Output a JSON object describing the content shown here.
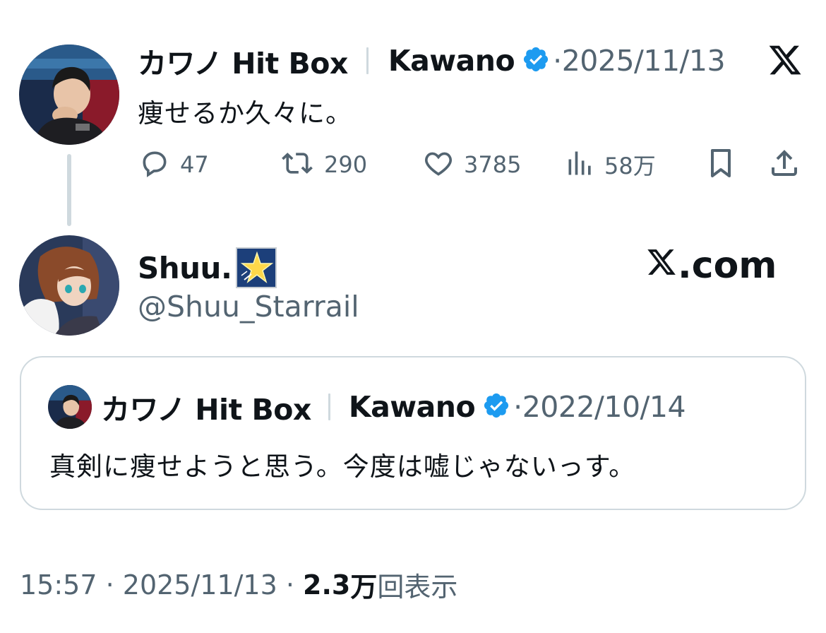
{
  "parent_tweet": {
    "author_name": "カワノ Hit Box",
    "author_handle_name": "Kawano",
    "date": "2025/11/13",
    "text": "痩せるか久々に。",
    "metrics": {
      "replies": "47",
      "retweets": "290",
      "likes": "3785",
      "views": "58万"
    }
  },
  "reply": {
    "author_name": "Shuu.",
    "handle": "@Shuu_Starrail",
    "site_label": ".com"
  },
  "quoted_tweet": {
    "author_name": "カワノ Hit Box",
    "author_handle_name": "Kawano",
    "date": "2022/10/14",
    "text": "真剣に痩せようと思う。今度は嘘じゃないっす。"
  },
  "footer": {
    "time": "15:57",
    "date": "2025/11/13",
    "views_count": "2.3",
    "views_unit": "万",
    "views_suffix": "回表示"
  },
  "icons": [
    "x-logo",
    "verified-badge",
    "reply-icon",
    "retweet-icon",
    "like-icon",
    "views-icon",
    "bookmark-icon",
    "share-icon",
    "star-emoji"
  ],
  "colors": {
    "text_primary": "#0f1419",
    "text_secondary": "#536471",
    "verified": "#1d9bf0",
    "border": "#cfd9de"
  }
}
